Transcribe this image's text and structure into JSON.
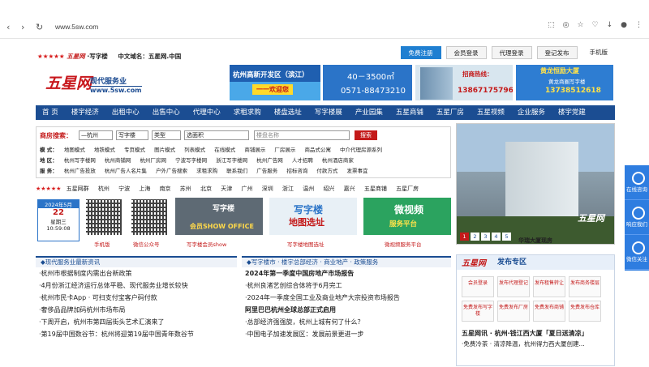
{
  "browser": {
    "url": "www.5sw.com"
  },
  "top": {
    "stars": "★★★★★",
    "logo_small": "五星网",
    "slogan": "·写字楼",
    "domain_line": "中文域名：五星网.中国",
    "buttons": [
      "免费注册",
      "会员登录",
      "代理登录",
      "登记发布",
      "手机版"
    ]
  },
  "header": {
    "logo_calli": "五星网",
    "logo_sub": "现代服务业",
    "logo_url": "www.5sw.com",
    "ad1_line1": "杭州高新开发区（滨江）",
    "ad1_line2": "一一欢迎您",
    "ad2_line1": "40－3500㎡",
    "ad2_line2": "0571-88473210",
    "ad3_line1": "招商热线：",
    "ad3_line2": "13867175796",
    "ad4_line1": "黄龙恒励大厦",
    "ad4_line1b": "黄龙商圈写字楼",
    "ad4_line2": "13738512618"
  },
  "nav": [
    "首 页",
    "楼宇经济",
    "出租中心",
    "出售中心",
    "代理中心",
    "求租求购",
    "楼盘选址",
    "写字楼展",
    "产业园集",
    "五星商铺",
    "五星厂房",
    "五星视频",
    "企业服务",
    "楼宇党建"
  ],
  "search": {
    "label": "商房搜索：",
    "selects": [
      "—杭州",
      "写字楼",
      "类型",
      "选面积"
    ],
    "placeholder": "楼盘名称",
    "button": "搜索",
    "line1": {
      "k": "模  式：",
      "v": [
        "地图模式",
        "地铁模式",
        "专页模式",
        "图片模式",
        "列表模式",
        "在线模式",
        "商铺展示",
        "厂房展示",
        "商品式公寓",
        "中介代理房源系列"
      ]
    },
    "line2": {
      "k": "地  区：",
      "v": [
        "杭州写字楼网",
        "杭州商铺网",
        "杭州厂房网",
        "宁波写字楼网",
        "浙江写字楼网",
        "杭州广告网",
        "人才招聘",
        "杭州酒店商家"
      ]
    },
    "line3": {
      "k": "服  务：",
      "v": [
        "杭州广告投放",
        "杭州广告人名片集",
        "户外广告搜索",
        "求租求购",
        "联系我们",
        "广告服务",
        "招标咨询",
        "付款方式",
        "发票事宜"
      ]
    }
  },
  "cities": {
    "stars": "★★★★★",
    "items": [
      "五星网群",
      "杭州",
      "宁波",
      "上海",
      "南京",
      "苏州",
      "北京",
      "天津",
      "广州",
      "深圳",
      "浙江",
      "温州",
      "绍兴",
      "嘉兴",
      "五星商铺",
      "五星厂房"
    ]
  },
  "date": {
    "month": "2024年5月",
    "day": "22",
    "week": "星期三",
    "time": "10:59:08"
  },
  "qr_labels": [
    "手机版",
    "微信公众号"
  ],
  "banners": {
    "b1_title": "写字楼",
    "b1_sub": "会员SHOW OFFICE",
    "b1_caption": "写字楼会员show",
    "b2_title": "写字楼",
    "b2_sub": "地图选址",
    "b2_caption": "写字楼地图选址",
    "b3_title": "微视频",
    "b3_sub": "服务平台",
    "b3_caption": "微视频服务平台"
  },
  "slideshow": {
    "pages": [
      "1",
      "2",
      "3",
      "4",
      "5"
    ],
    "active": "1",
    "signature": "五星网",
    "caption": "华瑞大厦现房"
  },
  "col1": {
    "heading": "◆现代服务业最新资讯",
    "items": [
      "·杭州市根据制度内需出台新政策",
      "·4月份浙江经济运行总体平稳、现代服务业增长较快",
      "·杭州市民卡App · 可扫支付宝客户码付款",
      "·奢侈品品牌加码杭州市场布局",
      "·下周开启，杭州市第四届街头艺术汇演来了",
      "·第19届中国数谷节：杭州将迎第19届中国青年数谷节"
    ]
  },
  "col2": {
    "heading": "◆写字楼市 · 楼宇总部经济 · 商业地产 · 政策服务",
    "items": [
      {
        "t": "2024年第一季度中国房地产市场报告",
        "b": true
      },
      {
        "t": "·杭州良渚艺创综合体将于6月完工",
        "b": false
      },
      {
        "t": "·2024年一季度全国工业及商业地产大宗投资市场报告",
        "b": false
      },
      {
        "t": "阿里巴巴杭州全球总部正式启用",
        "b": true
      },
      {
        "t": "·总部经济强强旋，杭州上城有何了什么？",
        "b": false
      },
      {
        "t": "·中国电子加速发展区：发展前景更进一步",
        "b": false
      }
    ]
  },
  "publish": {
    "logo": "五星网",
    "title": "发布专区",
    "cells": [
      "会员登录",
      "发布代理登记",
      "发布租售转让",
      "发布商务楼层",
      "免费发布写字楼",
      "免费发布厂房",
      "免费发布商铺",
      "免费发布仓库"
    ],
    "line1": "五星网讯 · 杭州·钱江西大厦「夏日送清凉」",
    "line2": "·免费冷茶 · 清凉降温，杭州得力西大厦创建..."
  },
  "float": [
    "在线咨询",
    "响应我们",
    "微信关注"
  ]
}
